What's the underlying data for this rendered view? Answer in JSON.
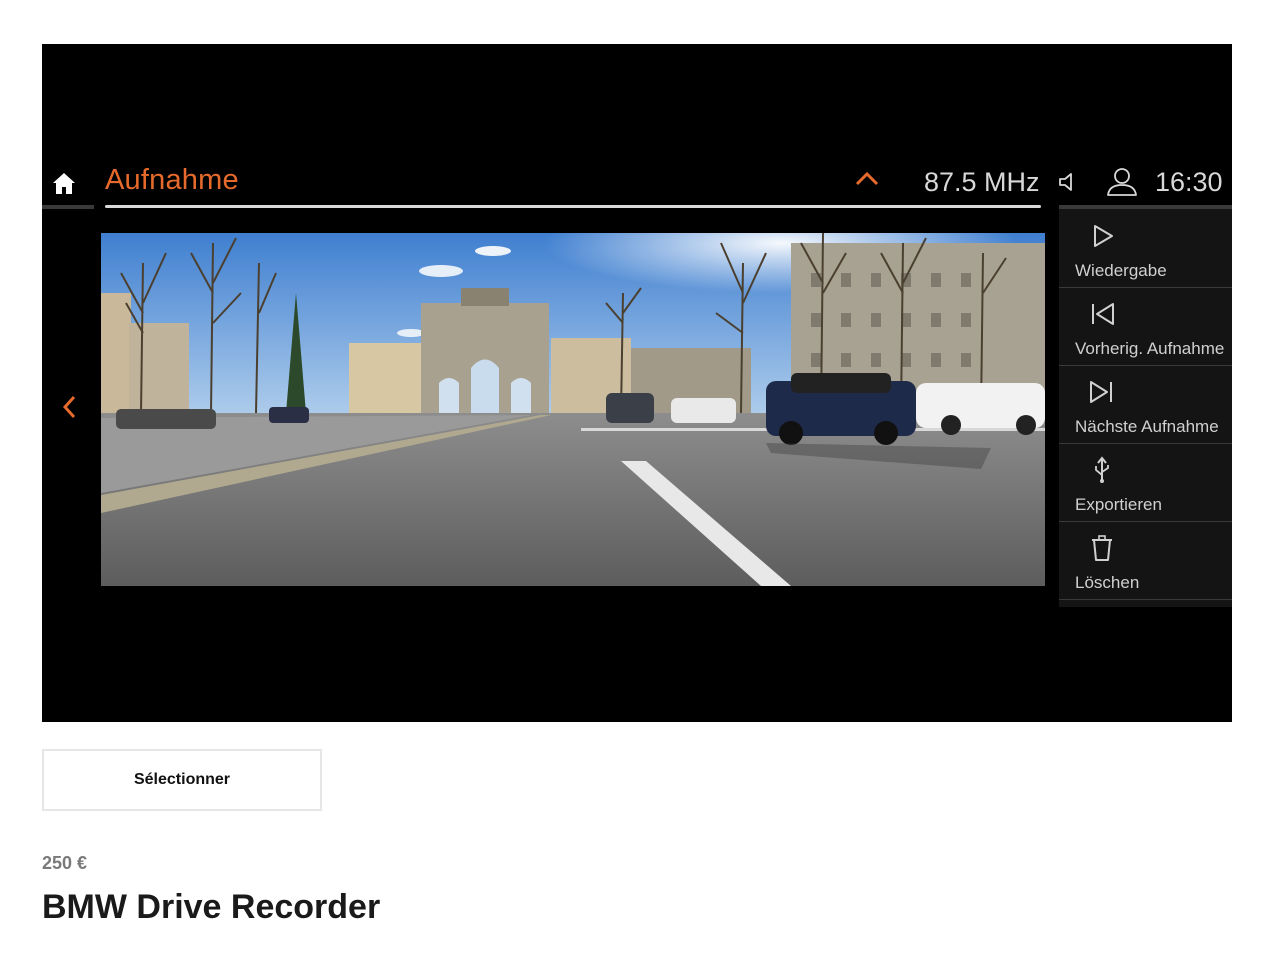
{
  "header": {
    "title": "Aufnahme",
    "frequency": "87.5 MHz",
    "clock": "16:30",
    "icons": [
      "home-icon",
      "chevron-up-icon",
      "speaker-icon",
      "profile-icon",
      "chevron-left-icon"
    ]
  },
  "side_menu": {
    "items": [
      {
        "label": "Wiedergabe",
        "icon": "play-icon"
      },
      {
        "label": "Vorherig. Aufnahme",
        "icon": "skip-back-icon"
      },
      {
        "label": "Nächste Aufnahme",
        "icon": "skip-forward-icon"
      },
      {
        "label": "Exportieren",
        "icon": "usb-icon"
      },
      {
        "label": "Löschen",
        "icon": "trash-icon"
      }
    ]
  },
  "product": {
    "select_label": "Sélectionner",
    "price": "250 €",
    "name": "BMW Drive Recorder"
  },
  "colors": {
    "accent": "#e66a2b",
    "screen_bg": "#000000",
    "sidebar_bg": "#141414"
  }
}
